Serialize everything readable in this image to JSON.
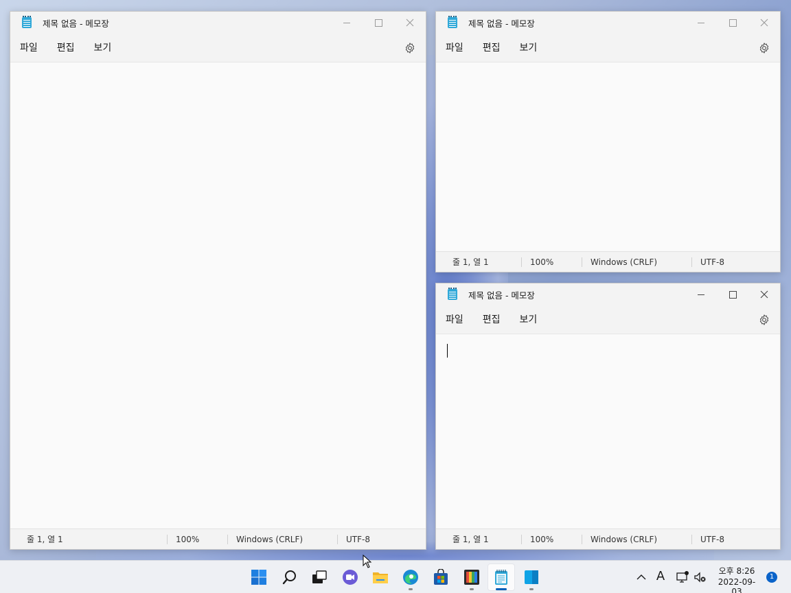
{
  "windows": [
    {
      "title": "제목 없음 - 메모장",
      "menu": [
        "파일",
        "편집",
        "보기"
      ],
      "status": {
        "position": "줄 1, 열 1",
        "zoom": "100%",
        "line_ending": "Windows (CRLF)",
        "encoding": "UTF-8"
      }
    },
    {
      "title": "제목 없음 - 메모장",
      "menu": [
        "파일",
        "편집",
        "보기"
      ],
      "status": {
        "position": "줄 1, 열 1",
        "zoom": "100%",
        "line_ending": "Windows (CRLF)",
        "encoding": "UTF-8"
      }
    },
    {
      "title": "제목 없음 - 메모장",
      "menu": [
        "파일",
        "편집",
        "보기"
      ],
      "status": {
        "position": "줄 1, 열 1",
        "zoom": "100%",
        "line_ending": "Windows (CRLF)",
        "encoding": "UTF-8"
      }
    }
  ],
  "taskbar": {
    "apps": [
      "start-icon",
      "search-icon",
      "task-view-icon",
      "chat-icon",
      "file-explorer-icon",
      "edge-icon",
      "store-icon",
      "paint-icon",
      "notepad-icon",
      "widgets-icon"
    ],
    "tray": {
      "time": "오후 8:26",
      "date": "2022-09-03",
      "ime": "A",
      "notifications": "1"
    }
  },
  "colors": {
    "accent": "#005fb8",
    "notepad": "#2fa8d8",
    "badge": "#0a63c9"
  }
}
